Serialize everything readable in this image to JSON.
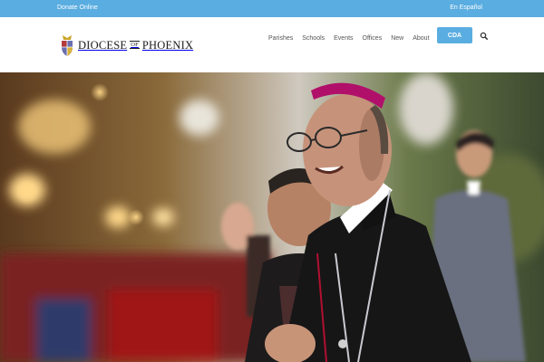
{
  "topbar": {
    "donate": "Donate Online",
    "language": "En Español"
  },
  "logo": {
    "word1": "DIOCESE",
    "of": "OF",
    "word2": "PHOENIX"
  },
  "nav": {
    "items": [
      {
        "label": "Parishes"
      },
      {
        "label": "Schools"
      },
      {
        "label": "Events"
      },
      {
        "label": "Offices"
      },
      {
        "label": "New"
      },
      {
        "label": "About"
      }
    ],
    "cta": "CDA"
  },
  "colors": {
    "accent": "#5aade0",
    "nav_text": "#555555"
  },
  "icons": {
    "search": "search-icon",
    "crest": "diocese-crest-icon"
  },
  "hero": {
    "description_image": "smiling-bishop-photo"
  }
}
